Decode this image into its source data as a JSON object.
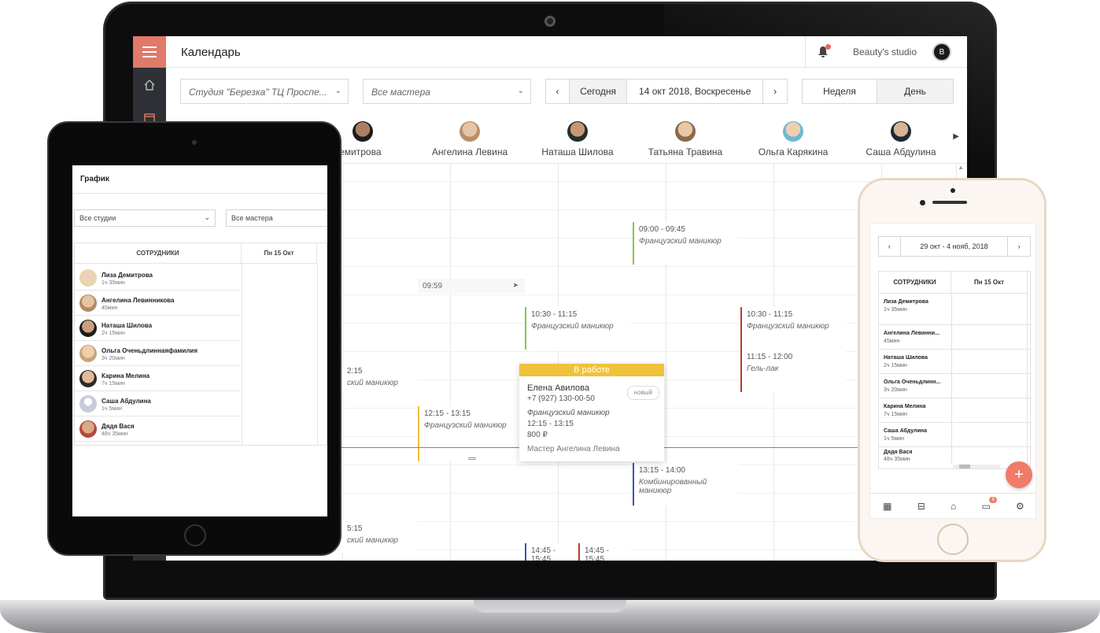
{
  "laptop": {
    "header": {
      "title": "Календарь",
      "studio_name": "Beauty's studio"
    },
    "filters": {
      "studio": "Студия \"Березка\" ТЦ Проспе...",
      "masters": "Все мастера",
      "today": "Сегодня",
      "date": "14 окт 2018, Воскресенье",
      "week": "Неделя",
      "day": "День"
    },
    "staff": [
      "а Демитрова",
      "Ангелина Левина",
      "Наташа Шилова",
      "Татьяна Травина",
      "Ольга Карякина",
      "Саша Абдулина"
    ],
    "events": [
      {
        "time": "09:00 - 09:45",
        "service": "Французский маникюр",
        "color": "#8bc34a"
      },
      {
        "time": "10:30 - 11:15",
        "service": "Французский маникюр",
        "color": "#8bc34a"
      },
      {
        "time": "10:30 - 11:15",
        "service": "Французский маникюр",
        "color": "#c0392b"
      },
      {
        "time": "11:15 - 12:00",
        "service": "Гель-лак",
        "color": "#c0392b"
      },
      {
        "time": "12:15 - 13:15",
        "service": "Французский маникюр",
        "color": "#f0c23b"
      },
      {
        "time": "13:15 - 14:00",
        "service": "Комбинированный маникюр",
        "color": "#3f51b5"
      },
      {
        "time": "14:45 - 15:45",
        "service": "",
        "color": "#3f51b5"
      },
      {
        "time": "14:45 - 15:45",
        "service": "",
        "color": "#c0392b"
      },
      {
        "time": "2:15",
        "service": "ский маникюр",
        "color": "#ffffff"
      },
      {
        "time": "5:15",
        "service": "ский маникюр",
        "color": "#ffffff"
      }
    ],
    "cursor_time": "09:59",
    "popup": {
      "status": "В работе",
      "client": "Елена Авилова",
      "badge": "новый",
      "phone": "+7 (927) 130-00-50",
      "service": "Французский маникюр",
      "time": "12:15 - 13:15",
      "price": "800 ₽",
      "master": "Мастер Ангелина Левина"
    },
    "colors": {
      "accent": "#e07a6a",
      "now_line": "#e55b4b",
      "popup_header": "#f0c23b"
    }
  },
  "tablet": {
    "title": "График",
    "studio_filter": "Все студии",
    "master_filter": "Все мастера",
    "col_staff": "СОТРУДНИКИ",
    "col_day": "Пн 15 Окт",
    "rows": [
      {
        "name": "Лиза Демитрова",
        "dur": "1ч 35мин"
      },
      {
        "name": "Ангелина Левинникова",
        "dur": "45мин"
      },
      {
        "name": "Наташа Шилова",
        "dur": "2ч 15мин"
      },
      {
        "name": "Ольга Оченьдлиннаяфамилия",
        "dur": "3ч 20мин"
      },
      {
        "name": "Карина Мелина",
        "dur": "7ч 15мин"
      },
      {
        "name": "Саша Абдулина",
        "dur": "1ч 5мин"
      },
      {
        "name": "Дядя Вася",
        "dur": "48ч 35мин"
      }
    ]
  },
  "phone": {
    "range": "29 окт - 4 нояб, 2018",
    "col_staff": "СОТРУДНИКИ",
    "col_day": "Пн 15 Окт",
    "rows": [
      {
        "name": "Лиза Демитрова",
        "dur": "1ч 35мин"
      },
      {
        "name": "Ангелина Левинни...",
        "dur": "45мин"
      },
      {
        "name": "Наташа Шилова",
        "dur": "2ч 15мин"
      },
      {
        "name": "Ольга Оченьдлинн...",
        "dur": "3ч 20мин"
      },
      {
        "name": "Карина Мелина",
        "dur": "7ч 15мин"
      },
      {
        "name": "Саша Абдулина",
        "dur": "1ч 5мин"
      },
      {
        "name": "Дядя Вася",
        "dur": "48ч 35мин"
      }
    ],
    "badge_count": "8"
  }
}
